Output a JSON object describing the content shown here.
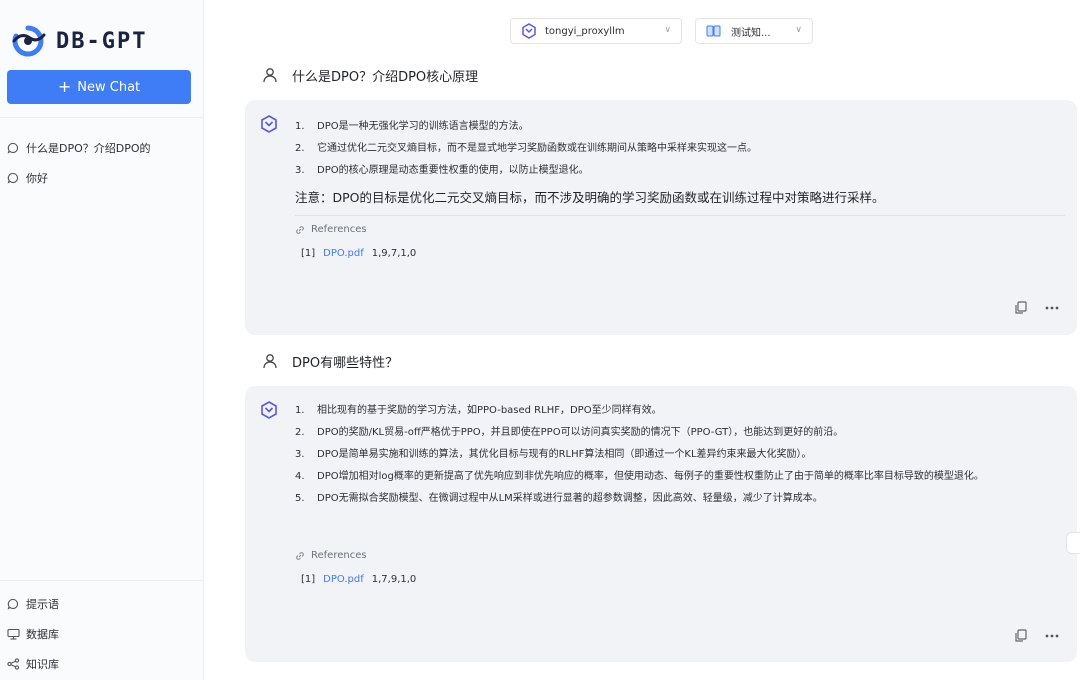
{
  "app": {
    "logo_text": "DB-GPT"
  },
  "sidebar": {
    "new_chat_label": "New Chat",
    "conversations": [
      {
        "label": "什么是DPO？介绍DPO的"
      },
      {
        "label": "你好"
      }
    ],
    "bottom_items": [
      {
        "label": "提示语",
        "icon": "chat-bubble-icon"
      },
      {
        "label": "数据库",
        "icon": "database-icon"
      },
      {
        "label": "知识库",
        "icon": "share-nodes-icon"
      }
    ]
  },
  "header": {
    "model_select": {
      "value": "tongyi_proxyllm"
    },
    "knowledge_select": {
      "value": "测试知..."
    }
  },
  "chat": {
    "messages": [
      {
        "question": "什么是DPO？介绍DPO核心原理",
        "answer": {
          "items": [
            "DPO是一种无强化学习的训练语言模型的方法。",
            "它通过优化二元交叉熵目标，而不是显式地学习奖励函数或在训练期间从策略中采样来实现这一点。",
            "DPO的核心原理是动态重要性权重的使用，以防止模型退化。"
          ],
          "note": "注意：DPO的目标是优化二元交叉熵目标，而不涉及明确的学习奖励函数或在训练过程中对策略进行采样。",
          "references_title": "References",
          "references": [
            {
              "index": "[1]",
              "file": "DPO.pdf",
              "pages": "1,9,7,1,0"
            }
          ]
        }
      },
      {
        "question": "DPO有哪些特性？",
        "answer": {
          "items": [
            "相比现有的基于奖励的学习方法，如PPO-based RLHF，DPO至少同样有效。",
            "DPO的奖励/KL贸易-off严格优于PPO，并且即使在PPO可以访问真实奖励的情况下（PPO-GT），也能达到更好的前沿。",
            "DPO是简单易实施和训练的算法，其优化目标与现有的RLHF算法相同（即通过一个KL差异约束来最大化奖励）。",
            "DPO增加相对log概率的更新提高了优先响应到非优先响应的概率，但使用动态、每例子的重要性权重防止了由于简单的概率比率目标导致的模型退化。",
            "DPO无需拟合奖励模型、在微调过程中从LM采样或进行显著的超参数调整，因此高效、轻量级，减少了计算成本。"
          ],
          "references_title": "References",
          "references": [
            {
              "index": "[1]",
              "file": "DPO.pdf",
              "pages": "1,7,9,1,0"
            }
          ]
        }
      }
    ]
  },
  "colors": {
    "accent": "#3f7df6",
    "bubble": "#f1f3f6",
    "sidebar": "#fafbfc"
  }
}
